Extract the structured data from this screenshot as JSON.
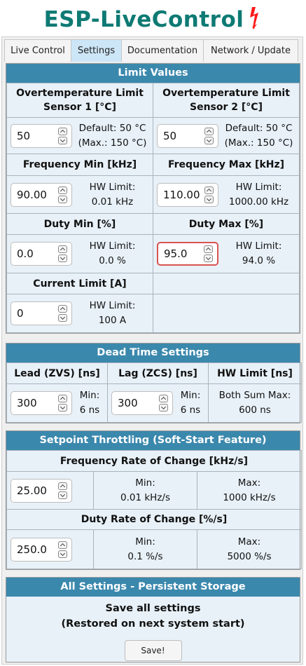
{
  "app": {
    "title": "ESP-LiveControl",
    "accent_color": "#0e7a74",
    "icon": "lightning-bolt-icon"
  },
  "tabs": [
    {
      "label": "Live Control",
      "active": false
    },
    {
      "label": "Settings",
      "active": true
    },
    {
      "label": "Documentation",
      "active": false
    },
    {
      "label": "Network / Update",
      "active": false
    }
  ],
  "limits": {
    "header": "Limit Values",
    "ot1": {
      "label": "Overtemperature Limit Sensor 1 [°C]",
      "value": "50",
      "info1": "Default: 50 °C",
      "info2": "(Max.: 150 °C)"
    },
    "ot2": {
      "label": "Overtemperature Limit Sensor 2 [°C]",
      "value": "50",
      "info1": "Default: 50 °C",
      "info2": "(Max.: 150 °C)"
    },
    "freq_min": {
      "label": "Frequency Min [kHz]",
      "value": "90.00",
      "info1": "HW Limit:",
      "info2": "0.01 kHz"
    },
    "freq_max": {
      "label": "Frequency Max [kHz]",
      "value": "110.00",
      "info1": "HW Limit:",
      "info2": "1000.00 kHz"
    },
    "duty_min": {
      "label": "Duty Min [%]",
      "value": "0.0",
      "info1": "HW Limit:",
      "info2": "0.0 %"
    },
    "duty_max": {
      "label": "Duty Max [%]",
      "value": "95.0",
      "info1": "HW Limit:",
      "info2": "94.0 %",
      "invalid": true
    },
    "current": {
      "label": "Current Limit [A]",
      "value": "0",
      "info1": "HW Limit:",
      "info2": "100 A"
    }
  },
  "deadtime": {
    "header": "Dead Time Settings",
    "lead": {
      "label": "Lead (ZVS) [ns]",
      "value": "300",
      "info1": "Min:",
      "info2": "6 ns"
    },
    "lag": {
      "label": "Lag (ZCS) [ns]",
      "value": "300",
      "info1": "Min:",
      "info2": "6 ns"
    },
    "hw": {
      "label": "HW Limit [ns]",
      "info1": "Both Sum Max:",
      "info2": "600 ns"
    }
  },
  "throttle": {
    "header": "Setpoint Throttling (Soft-Start Feature)",
    "freq": {
      "label": "Frequency Rate of Change [kHz/s]",
      "value": "25.00",
      "min_label": "Min:",
      "min_value": "0.01 kHz/s",
      "max_label": "Max:",
      "max_value": "1000 kHz/s"
    },
    "duty": {
      "label": "Duty Rate of Change [%/s]",
      "value": "250.0",
      "min_label": "Min:",
      "min_value": "0.1 %/s",
      "max_label": "Max:",
      "max_value": "5000 %/s"
    }
  },
  "persist": {
    "header": "All Settings - Persistent Storage",
    "line1": "Save all settings",
    "line2": "(Restored on next system start)",
    "button": "Save!"
  }
}
